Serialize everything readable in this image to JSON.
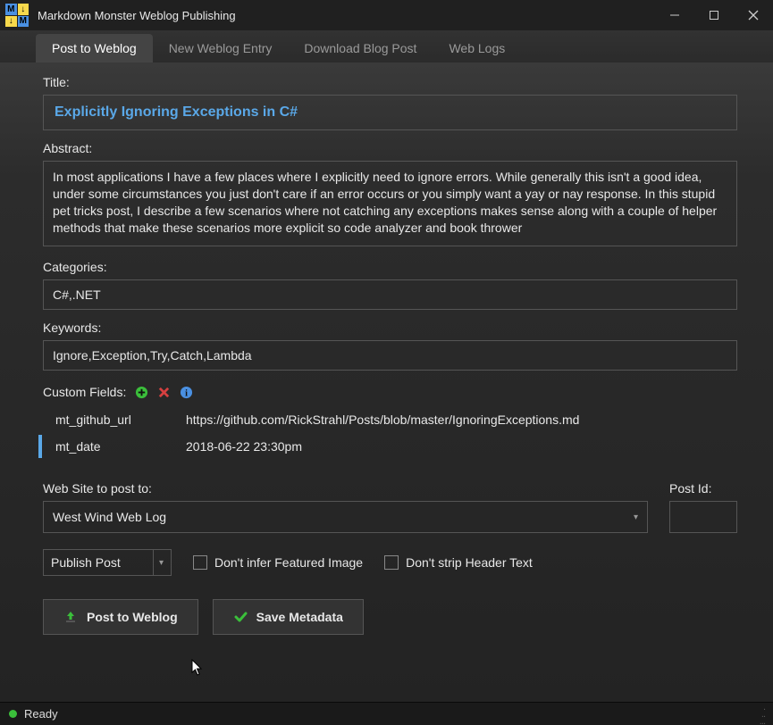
{
  "window": {
    "title": "Markdown Monster Weblog Publishing"
  },
  "tabs": {
    "post": "Post to Weblog",
    "new": "New Weblog Entry",
    "download": "Download Blog Post",
    "logs": "Web Logs"
  },
  "labels": {
    "title": "Title:",
    "abstract": "Abstract:",
    "categories": "Categories:",
    "keywords": "Keywords:",
    "customFields": "Custom Fields:",
    "site": "Web Site to post to:",
    "postId": "Post Id:"
  },
  "fields": {
    "title": "Explicitly Ignoring Exceptions in C#",
    "abstract": "In most applications I have a few places where I explicitly need to ignore errors. While generally this isn't a good idea, under some circumstances you just don't care if an error occurs or you simply want a yay or nay response. In this stupid pet tricks post, I describe a few scenarios where not catching any exceptions makes sense along with a couple of helper methods that make these scenarios more explicit so code analyzer and book thrower",
    "categories": "C#,.NET",
    "keywords": "Ignore,Exception,Try,Catch,Lambda",
    "site": "West Wind Web Log",
    "postId": "",
    "publishMode": "Publish Post"
  },
  "customFields": [
    {
      "name": "mt_github_url",
      "value": "https://github.com/RickStrahl/Posts/blob/master/IgnoringExceptions.md"
    },
    {
      "name": "mt_date",
      "value": "2018-06-22 23:30pm"
    }
  ],
  "checkboxes": {
    "inferImage": "Don't infer Featured Image",
    "stripHeader": "Don't strip Header Text"
  },
  "buttons": {
    "post": "Post to Weblog",
    "save": "Save Metadata"
  },
  "status": {
    "text": "Ready"
  }
}
